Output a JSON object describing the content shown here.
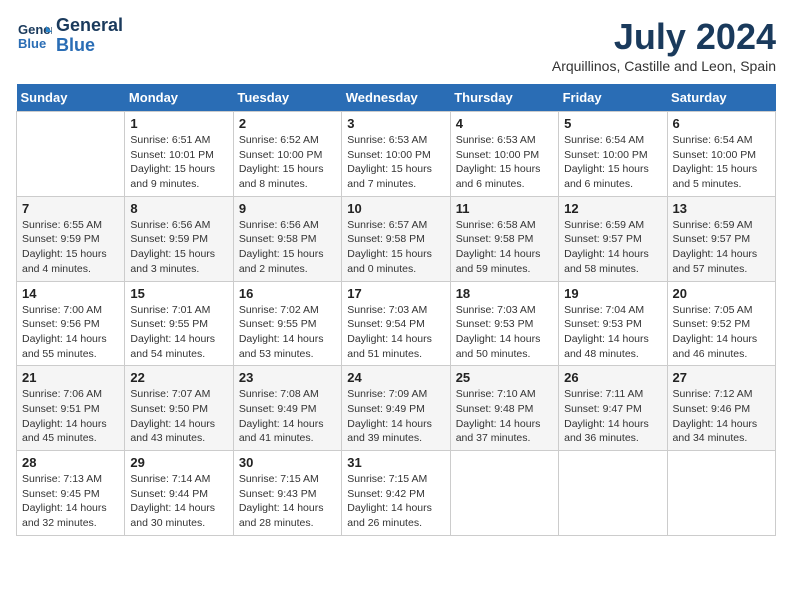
{
  "header": {
    "logo_line1": "General",
    "logo_line2": "Blue",
    "month": "July 2024",
    "location": "Arquillinos, Castille and Leon, Spain"
  },
  "weekdays": [
    "Sunday",
    "Monday",
    "Tuesday",
    "Wednesday",
    "Thursday",
    "Friday",
    "Saturday"
  ],
  "weeks": [
    [
      {
        "day": "",
        "info": ""
      },
      {
        "day": "1",
        "info": "Sunrise: 6:51 AM\nSunset: 10:01 PM\nDaylight: 15 hours\nand 9 minutes."
      },
      {
        "day": "2",
        "info": "Sunrise: 6:52 AM\nSunset: 10:00 PM\nDaylight: 15 hours\nand 8 minutes."
      },
      {
        "day": "3",
        "info": "Sunrise: 6:53 AM\nSunset: 10:00 PM\nDaylight: 15 hours\nand 7 minutes."
      },
      {
        "day": "4",
        "info": "Sunrise: 6:53 AM\nSunset: 10:00 PM\nDaylight: 15 hours\nand 6 minutes."
      },
      {
        "day": "5",
        "info": "Sunrise: 6:54 AM\nSunset: 10:00 PM\nDaylight: 15 hours\nand 6 minutes."
      },
      {
        "day": "6",
        "info": "Sunrise: 6:54 AM\nSunset: 10:00 PM\nDaylight: 15 hours\nand 5 minutes."
      }
    ],
    [
      {
        "day": "7",
        "info": "Sunrise: 6:55 AM\nSunset: 9:59 PM\nDaylight: 15 hours\nand 4 minutes."
      },
      {
        "day": "8",
        "info": "Sunrise: 6:56 AM\nSunset: 9:59 PM\nDaylight: 15 hours\nand 3 minutes."
      },
      {
        "day": "9",
        "info": "Sunrise: 6:56 AM\nSunset: 9:58 PM\nDaylight: 15 hours\nand 2 minutes."
      },
      {
        "day": "10",
        "info": "Sunrise: 6:57 AM\nSunset: 9:58 PM\nDaylight: 15 hours\nand 0 minutes."
      },
      {
        "day": "11",
        "info": "Sunrise: 6:58 AM\nSunset: 9:58 PM\nDaylight: 14 hours\nand 59 minutes."
      },
      {
        "day": "12",
        "info": "Sunrise: 6:59 AM\nSunset: 9:57 PM\nDaylight: 14 hours\nand 58 minutes."
      },
      {
        "day": "13",
        "info": "Sunrise: 6:59 AM\nSunset: 9:57 PM\nDaylight: 14 hours\nand 57 minutes."
      }
    ],
    [
      {
        "day": "14",
        "info": "Sunrise: 7:00 AM\nSunset: 9:56 PM\nDaylight: 14 hours\nand 55 minutes."
      },
      {
        "day": "15",
        "info": "Sunrise: 7:01 AM\nSunset: 9:55 PM\nDaylight: 14 hours\nand 54 minutes."
      },
      {
        "day": "16",
        "info": "Sunrise: 7:02 AM\nSunset: 9:55 PM\nDaylight: 14 hours\nand 53 minutes."
      },
      {
        "day": "17",
        "info": "Sunrise: 7:03 AM\nSunset: 9:54 PM\nDaylight: 14 hours\nand 51 minutes."
      },
      {
        "day": "18",
        "info": "Sunrise: 7:03 AM\nSunset: 9:53 PM\nDaylight: 14 hours\nand 50 minutes."
      },
      {
        "day": "19",
        "info": "Sunrise: 7:04 AM\nSunset: 9:53 PM\nDaylight: 14 hours\nand 48 minutes."
      },
      {
        "day": "20",
        "info": "Sunrise: 7:05 AM\nSunset: 9:52 PM\nDaylight: 14 hours\nand 46 minutes."
      }
    ],
    [
      {
        "day": "21",
        "info": "Sunrise: 7:06 AM\nSunset: 9:51 PM\nDaylight: 14 hours\nand 45 minutes."
      },
      {
        "day": "22",
        "info": "Sunrise: 7:07 AM\nSunset: 9:50 PM\nDaylight: 14 hours\nand 43 minutes."
      },
      {
        "day": "23",
        "info": "Sunrise: 7:08 AM\nSunset: 9:49 PM\nDaylight: 14 hours\nand 41 minutes."
      },
      {
        "day": "24",
        "info": "Sunrise: 7:09 AM\nSunset: 9:49 PM\nDaylight: 14 hours\nand 39 minutes."
      },
      {
        "day": "25",
        "info": "Sunrise: 7:10 AM\nSunset: 9:48 PM\nDaylight: 14 hours\nand 37 minutes."
      },
      {
        "day": "26",
        "info": "Sunrise: 7:11 AM\nSunset: 9:47 PM\nDaylight: 14 hours\nand 36 minutes."
      },
      {
        "day": "27",
        "info": "Sunrise: 7:12 AM\nSunset: 9:46 PM\nDaylight: 14 hours\nand 34 minutes."
      }
    ],
    [
      {
        "day": "28",
        "info": "Sunrise: 7:13 AM\nSunset: 9:45 PM\nDaylight: 14 hours\nand 32 minutes."
      },
      {
        "day": "29",
        "info": "Sunrise: 7:14 AM\nSunset: 9:44 PM\nDaylight: 14 hours\nand 30 minutes."
      },
      {
        "day": "30",
        "info": "Sunrise: 7:15 AM\nSunset: 9:43 PM\nDaylight: 14 hours\nand 28 minutes."
      },
      {
        "day": "31",
        "info": "Sunrise: 7:15 AM\nSunset: 9:42 PM\nDaylight: 14 hours\nand 26 minutes."
      },
      {
        "day": "",
        "info": ""
      },
      {
        "day": "",
        "info": ""
      },
      {
        "day": "",
        "info": ""
      }
    ]
  ]
}
